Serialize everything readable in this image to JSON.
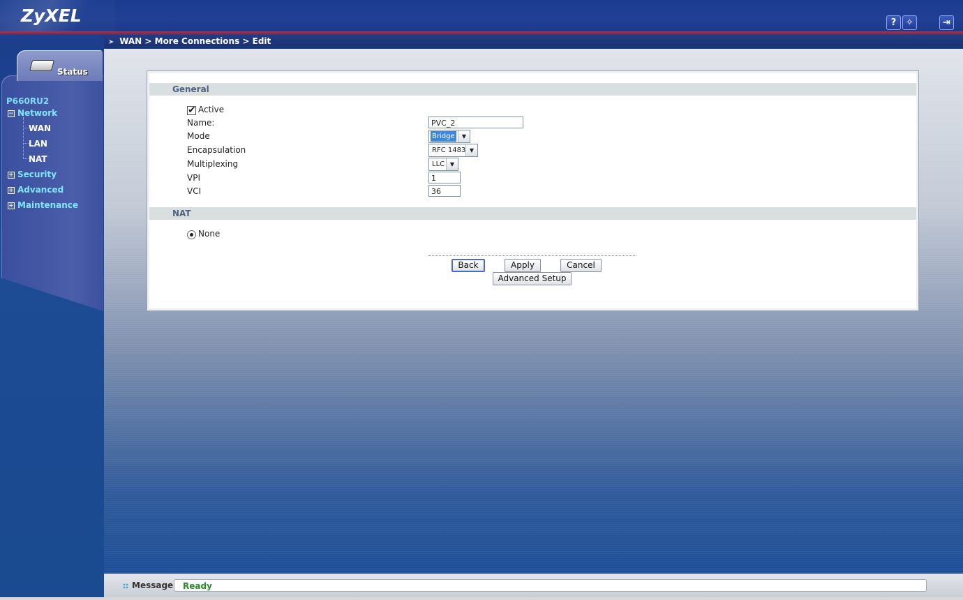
{
  "header": {
    "logo": "ZyXEL",
    "icons": [
      "help-icon",
      "wizard-icon",
      "logout-icon"
    ]
  },
  "breadcrumb": "WAN > More Connections > Edit",
  "sidebar": {
    "status_tab": "Status",
    "device": "P660RU2",
    "menu": [
      {
        "label": "Network",
        "expanded": true,
        "children": [
          "WAN",
          "LAN",
          "NAT"
        ]
      },
      {
        "label": "Security",
        "expanded": false
      },
      {
        "label": "Advanced",
        "expanded": false
      },
      {
        "label": "Maintenance",
        "expanded": false
      }
    ]
  },
  "general": {
    "title": "General",
    "active_label": "Active",
    "active_checked": true,
    "name_label": "Name:",
    "name_value": "PVC_2",
    "mode_label": "Mode",
    "mode_value": "Bridge",
    "encap_label": "Encapsulation",
    "encap_value": "RFC 1483",
    "mux_label": "Multiplexing",
    "mux_value": "LLC",
    "vpi_label": "VPI",
    "vpi_value": "1",
    "vci_label": "VCI",
    "vci_value": "36"
  },
  "nat": {
    "title": "NAT",
    "option_label": "None",
    "selected": true
  },
  "buttons": {
    "back": "Back",
    "apply": "Apply",
    "cancel": "Cancel",
    "advanced": "Advanced Setup"
  },
  "statusbar": {
    "label": "Message",
    "message": "Ready",
    "message_color": "#2c8a2c"
  }
}
